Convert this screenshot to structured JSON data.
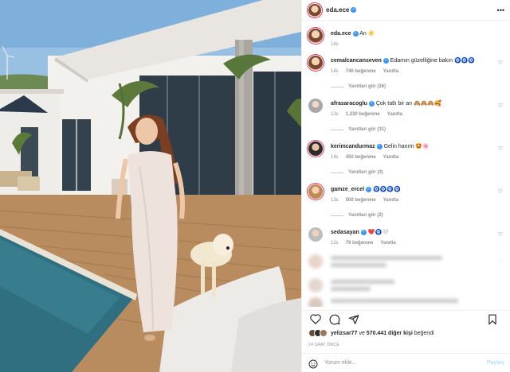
{
  "post": {
    "username": "eda.ece",
    "caption_user": "eda.ece",
    "caption_text": "An",
    "caption_emoji": "☀️",
    "caption_time": "14s"
  },
  "comments": [
    {
      "user": "cemalcancanseven",
      "text": "Edamın güzelliğine bakın",
      "emoji": "🧿🧿🧿",
      "time": "14s",
      "likes": "746 beğenme",
      "reply": "Yanıtla",
      "view_replies": "Yanıtları gör (16)",
      "verified": true
    },
    {
      "user": "afrasaracoglu",
      "text": "Çok tatlı bir an",
      "emoji": "🙈🙈🙈🥰",
      "time": "13s",
      "likes": "1.230 beğenme",
      "reply": "Yanıtla",
      "view_replies": "Yanıtları gör (31)",
      "verified": true
    },
    {
      "user": "kerimcandurmaz",
      "text": "Gelin hanım",
      "emoji": "🤩🌸",
      "time": "14s",
      "likes": "450 beğenme",
      "reply": "Yanıtla",
      "view_replies": "Yanıtları gör (3)",
      "verified": true
    },
    {
      "user": "gamze_ercel",
      "text": "",
      "emoji": "🧿🧿🧿🧿",
      "time": "13s",
      "likes": "500 beğenme",
      "reply": "Yanıtla",
      "view_replies": "Yanıtları gör (2)",
      "verified": true
    },
    {
      "user": "sedasayan",
      "text": "",
      "emoji": "❤️🧿🤍",
      "time": "12s",
      "likes": "79 beğenme",
      "reply": "Yanıtla",
      "view_replies": "",
      "verified": true
    }
  ],
  "actions": {
    "like_icon": "heart-icon",
    "comment_icon": "comment-icon",
    "share_icon": "send-icon",
    "save_icon": "bookmark-icon"
  },
  "likes": {
    "user": "yelizsar77",
    "connector": "ve",
    "count_text": "570.441 diğer kişi",
    "suffix": "beğendi"
  },
  "timestamp": "14 SAAT ÖNCE",
  "comment_input": {
    "placeholder": "Yorum ekle...",
    "post_label": "Paylaş"
  },
  "colors": {
    "accent": "#3897f0",
    "story_ring": "#e3315a",
    "post_disabled": "#b2dffc"
  }
}
